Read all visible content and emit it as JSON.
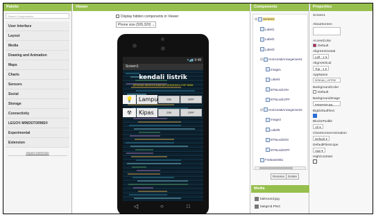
{
  "palette": {
    "header": "Palette",
    "search_placeholder": "Search Components...",
    "categories": [
      "User Interface",
      "Layout",
      "Media",
      "Drawing and Animation",
      "Maps",
      "Charts",
      "Sensors",
      "Social",
      "Storage",
      "Connectivity",
      "LEGO® MINDSTORMS®",
      "Experimental",
      "Extension"
    ],
    "import_extension": "Import extension"
  },
  "viewer": {
    "header": "Viewer",
    "hidden_checkbox_label": "Display hidden components in Viewer",
    "phone_size": "Phone size (505,320)",
    "phone": {
      "status_time": "9:48",
      "screen_title": "Screen1",
      "app_title": "kendali listrik",
      "app_subtitle": "DENGAN MENGGUNAKAN MODEMCU ESP 8266",
      "rows": [
        {
          "icon": "💡",
          "label": "Lampu",
          "on": "ON",
          "off": "OFF"
        },
        {
          "icon": "☢",
          "label": "Kipas",
          "on": "ON",
          "off": "OFF"
        }
      ],
      "nav_back": "◁",
      "nav_home": "○",
      "nav_recent": "□"
    }
  },
  "components": {
    "header": "Components",
    "tree": [
      {
        "label": "Screen1",
        "level": 0,
        "toggle": "⊟",
        "selected": true
      },
      {
        "label": "Label1",
        "level": 1
      },
      {
        "label": "Label2",
        "level": 1
      },
      {
        "label": "Label3",
        "level": 1
      },
      {
        "label": "HorizontalArrangement1",
        "level": 1,
        "toggle": "⊟"
      },
      {
        "label": "Image1",
        "level": 2
      },
      {
        "label": "Label4",
        "level": 2
      },
      {
        "label": "BTNLed1ON",
        "level": 2
      },
      {
        "label": "BTNLed1OFF",
        "level": 2
      },
      {
        "label": "HorizontalArrangement2",
        "level": 1,
        "toggle": "⊟"
      },
      {
        "label": "Image2",
        "level": 2
      },
      {
        "label": "Label5",
        "level": 2
      },
      {
        "label": "BTNLed2ON",
        "level": 2
      },
      {
        "label": "BTNLed2OFF",
        "level": 2
      },
      {
        "label": "FirebaseDB1",
        "level": 1
      }
    ],
    "rename_button": "Rename",
    "delete_button": "Delete",
    "media_header": "Media",
    "media": [
      "bakround.jpg",
      "bakgrnd.PNG"
    ]
  },
  "properties": {
    "header": "Properties",
    "component": "Screen1",
    "about_screen_label": "AboutScreen",
    "accent_color_label": "AccentColor",
    "accent_color_value": "Default",
    "align_horizontal_label": "AlignHorizontal",
    "align_horizontal_value": "Left : 1 ▾",
    "align_vertical_label": "AlignVertical",
    "align_vertical_value": "Top : 1 ▾",
    "app_name_label": "AppName",
    "app_name_value": "KENDALI_LISTRIK",
    "background_color_label": "BackgroundColor",
    "background_color_value": "Default",
    "background_image_label": "BackgroundImage",
    "background_image_value": "bakgrndpk.jpg...",
    "big_default_text_label": "BigDefaultText",
    "blocks_toolkit_label": "BlocksToolkit",
    "blocks_toolkit_value": "All ▾",
    "close_screen_anim_label": "CloseScreenAnimation",
    "close_screen_anim_value": "Default ▾",
    "default_file_scope_label": "DefaultFileScope",
    "default_file_scope_value": "App ▾",
    "high_contrast_label": "HighContrast"
  },
  "colors": {
    "header_green": "#97bf4e",
    "accent_swatch": "#c2185b",
    "checkbox_blue": "#2b6dd6"
  }
}
